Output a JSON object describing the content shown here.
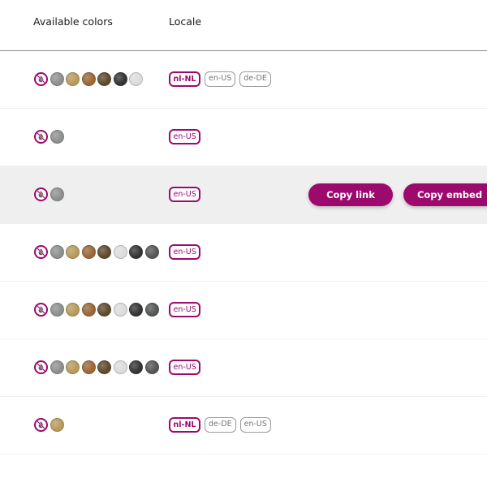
{
  "header": {
    "colors_label": "Available colors",
    "locale_label": "Locale"
  },
  "colors": {
    "none": "#ffffff",
    "gray": "#8e9090",
    "gold": "#b79a5c",
    "bronze": "#9a6738",
    "brown": "#5e4a2e",
    "black": "#343434",
    "white": "#dcdcdc",
    "graphite": "#555656"
  },
  "accent": "#9c0a6e",
  "rows": [
    {
      "swatches": [
        "none",
        "gray",
        "gold",
        "bronze",
        "brown",
        "black",
        "white"
      ],
      "locales": [
        {
          "label": "nl-NL",
          "active": true
        },
        {
          "label": "en-US",
          "active": false
        },
        {
          "label": "de-DE",
          "active": false
        }
      ],
      "hover": false
    },
    {
      "swatches": [
        "none",
        "gray"
      ],
      "locales": [
        {
          "label": "en-US",
          "active": true
        }
      ],
      "hover": false
    },
    {
      "swatches": [
        "none",
        "gray"
      ],
      "locales": [
        {
          "label": "en-US",
          "active": true
        }
      ],
      "hover": true
    },
    {
      "swatches": [
        "none",
        "gray",
        "gold",
        "bronze",
        "brown",
        "white",
        "black",
        "graphite"
      ],
      "locales": [
        {
          "label": "en-US",
          "active": true
        }
      ],
      "hover": false
    },
    {
      "swatches": [
        "none",
        "gray",
        "gold",
        "bronze",
        "brown",
        "white",
        "black",
        "graphite"
      ],
      "locales": [
        {
          "label": "en-US",
          "active": true
        }
      ],
      "hover": false
    },
    {
      "swatches": [
        "none",
        "gray",
        "gold",
        "bronze",
        "brown",
        "white",
        "black",
        "graphite"
      ],
      "locales": [
        {
          "label": "en-US",
          "active": true
        }
      ],
      "hover": false
    },
    {
      "swatches": [
        "none",
        "gold"
      ],
      "locales": [
        {
          "label": "nl-NL",
          "active": true
        },
        {
          "label": "de-DE",
          "active": false
        },
        {
          "label": "en-US",
          "active": false
        }
      ],
      "hover": false
    }
  ],
  "actions": {
    "copy_link": "Copy link",
    "copy_embed": "Copy embed"
  }
}
